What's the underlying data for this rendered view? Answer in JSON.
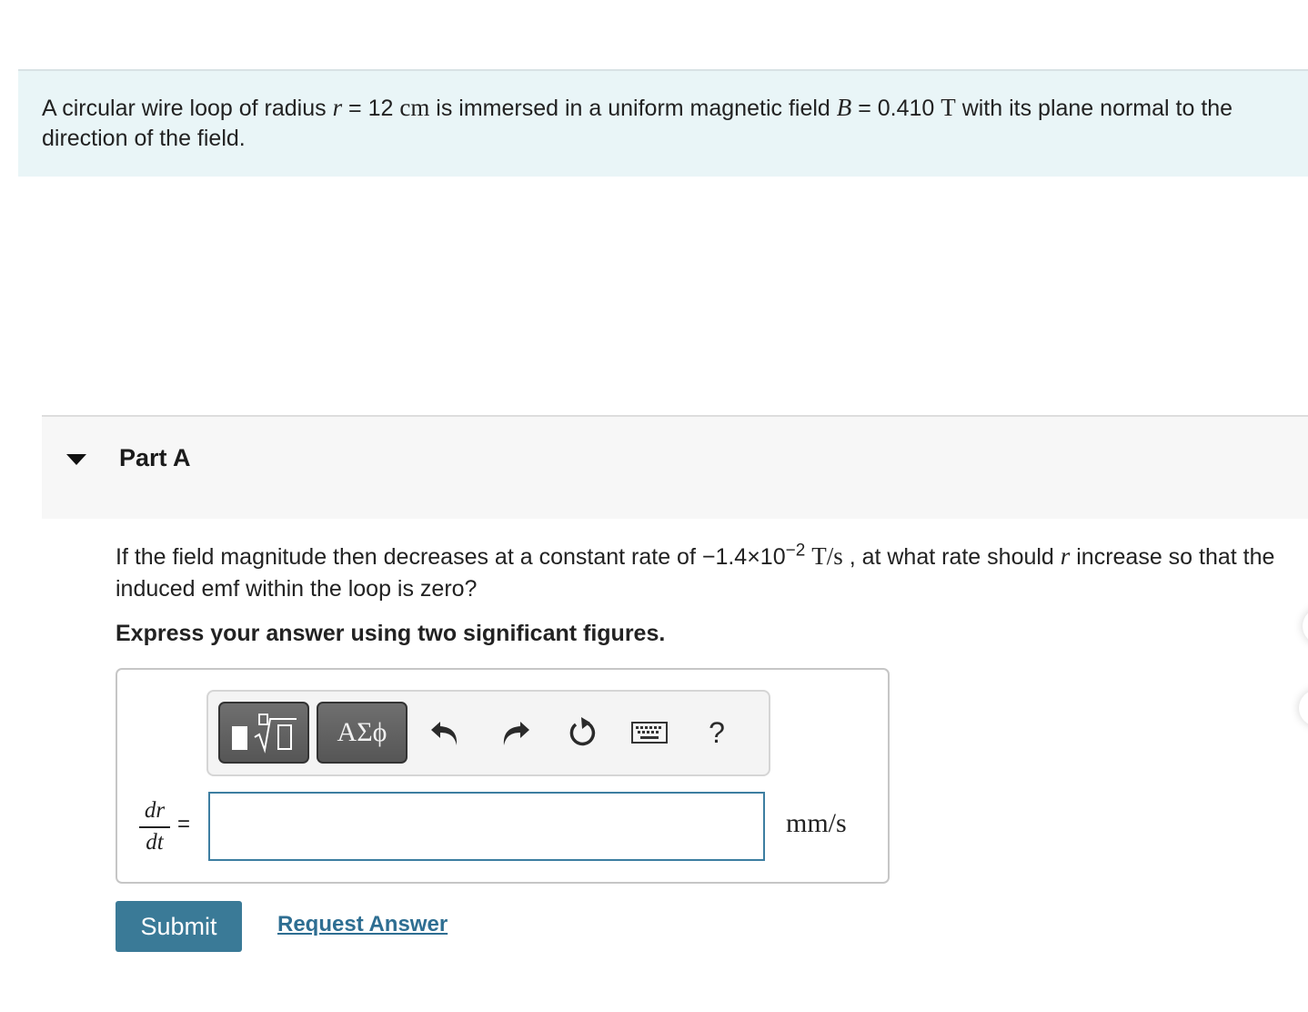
{
  "problem": {
    "t1": "A circular wire loop of radius ",
    "r": "r",
    "t2": " = 12 ",
    "cm": "cm",
    "t3": " is immersed in a uniform magnetic field ",
    "B": "B",
    "t4": " = 0.410 ",
    "T": "T",
    "t5": " with its plane normal to the direction of the field."
  },
  "part": {
    "title": "Part A"
  },
  "question": {
    "t1": "If the field magnitude then decreases at a constant rate of −1.4×10",
    "exp": "−2",
    "unit": "T/s",
    "t2": " , at what rate should ",
    "r": "r",
    "t3": " increase so that the induced emf within the loop is zero?"
  },
  "instruction": "Express your answer using two significant figures.",
  "toolbar": {
    "templates_icon": "templates-sqrt-icon",
    "greek_label": "ΑΣϕ",
    "undo_icon": "undo-icon",
    "redo_icon": "redo-icon",
    "reset_icon": "reset-icon",
    "keyboard_icon": "keyboard-icon",
    "help_label": "?"
  },
  "answer": {
    "numerator": "dr",
    "denominator": "dt",
    "equals": "=",
    "value": "",
    "units": "mm/s"
  },
  "actions": {
    "submit_label": "Submit",
    "request_label": "Request Answer"
  }
}
